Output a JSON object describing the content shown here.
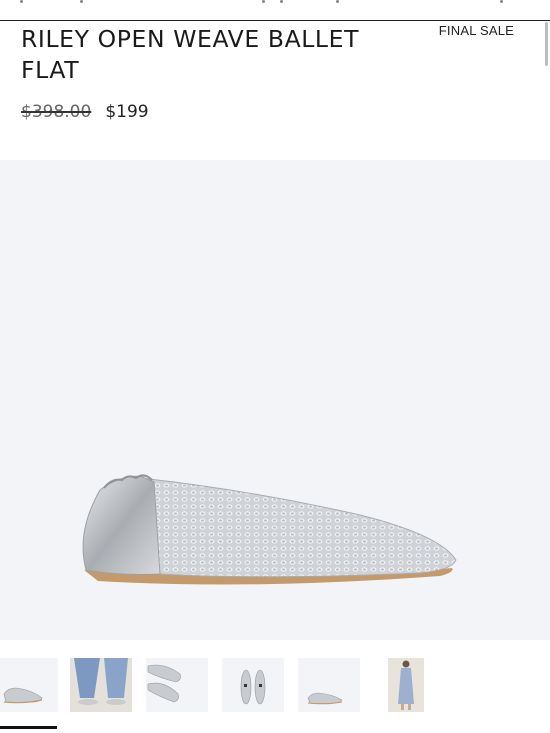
{
  "product": {
    "title": "RILEY OPEN WEAVE BALLET FLAT",
    "badge": "FINAL SALE",
    "original_price": "$398.00",
    "sale_price": "$199"
  },
  "gallery": {
    "main_image": "silver-woven-ballet-flat-side-view",
    "thumbnails": [
      {
        "view": "side-view-flat",
        "selected": true
      },
      {
        "view": "model-feet-jeans"
      },
      {
        "view": "top-view-pair"
      },
      {
        "view": "overhead-soles"
      },
      {
        "view": "side-view-small"
      },
      {
        "view": "model-full-dress"
      }
    ]
  },
  "colors": {
    "background": "#ffffff",
    "hero_background": "#f3f4f8",
    "text": "#1a1a1a",
    "silver": "#c9ccd0",
    "sole": "#c59a6a"
  }
}
